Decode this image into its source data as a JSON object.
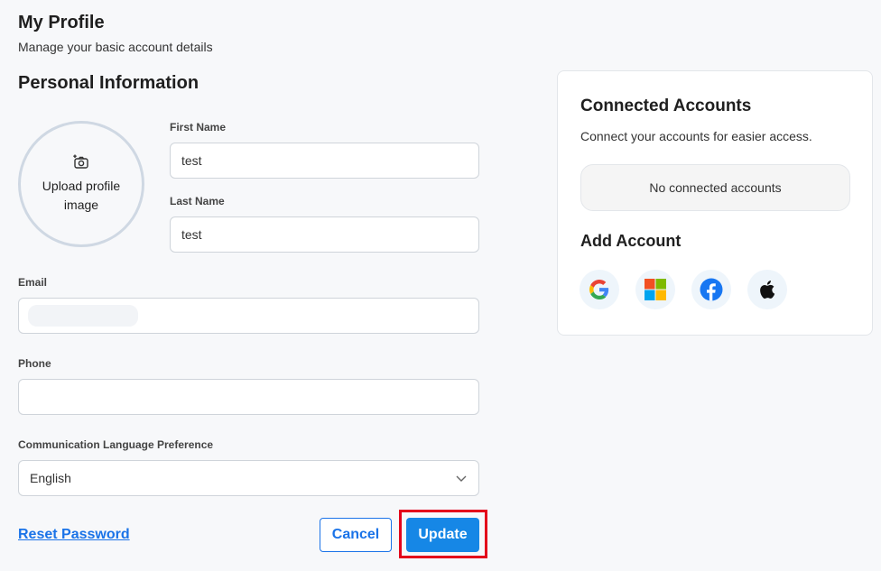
{
  "header": {
    "title": "My Profile",
    "subtitle": "Manage your basic account details"
  },
  "personal": {
    "title": "Personal Information",
    "avatar": {
      "label": "Upload profile image",
      "icon": "camera-add-icon"
    },
    "first_name": {
      "label": "First Name",
      "value": "test"
    },
    "last_name": {
      "label": "Last Name",
      "value": "test"
    },
    "email": {
      "label": "Email",
      "value": ""
    },
    "phone": {
      "label": "Phone",
      "value": ""
    },
    "language": {
      "label": "Communication Language Preference",
      "value": "English",
      "icon": "chevron-down-icon"
    }
  },
  "actions": {
    "reset_password": "Reset Password",
    "cancel": "Cancel",
    "update": "Update",
    "highlight_color": "#e3001b",
    "primary_color": "#1687e6"
  },
  "connected": {
    "title": "Connected Accounts",
    "description": "Connect your accounts for easier access.",
    "empty_text": "No connected accounts",
    "add_title": "Add Account",
    "providers": [
      {
        "name": "Google",
        "icon": "google-icon"
      },
      {
        "name": "Microsoft",
        "icon": "microsoft-icon"
      },
      {
        "name": "Facebook",
        "icon": "facebook-icon"
      },
      {
        "name": "Apple",
        "icon": "apple-icon"
      }
    ]
  }
}
